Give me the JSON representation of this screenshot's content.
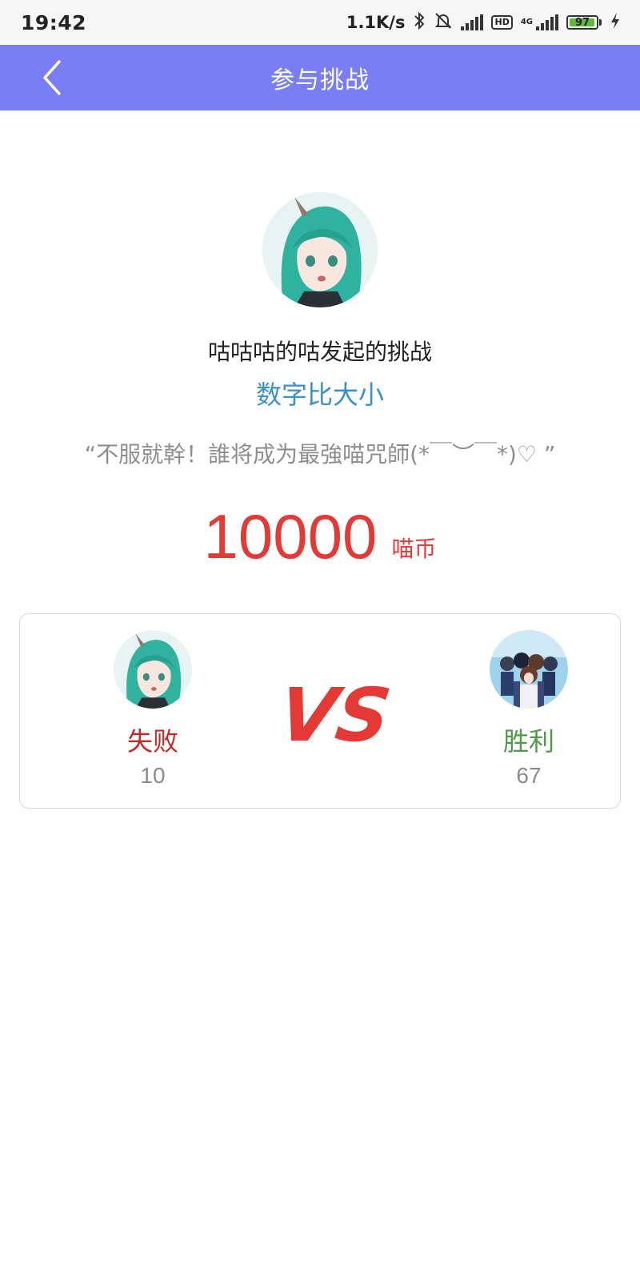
{
  "status_bar": {
    "time": "19:42",
    "net_speed": "1.1K/s",
    "network_type": "4G",
    "hd_label": "HD",
    "battery_level": "97",
    "battery_fraction": 0.97,
    "icons": [
      "bluetooth-icon",
      "mute-icon",
      "signal-icon",
      "signal-icon",
      "charging-icon"
    ]
  },
  "header": {
    "title": "参与挑战",
    "back_icon": "chevron-left-icon"
  },
  "challenge": {
    "initiator_line": "咕咕咕的咕发起的挑战",
    "game_name": "数字比大小",
    "quote": "“不服就幹！誰将成为最強喵咒師(*￣︶￣*)♡ ”",
    "amount": "10000",
    "currency": "喵币"
  },
  "match": {
    "left": {
      "result": "失败",
      "score": "10"
    },
    "vs_label": "VS",
    "right": {
      "result": "胜利",
      "score": "67"
    }
  },
  "colors": {
    "header_bg": "#7a7ef5",
    "game_name": "#3a8fcd",
    "amount": "#e53935",
    "lose": "#c62828",
    "win": "#4f9a45",
    "vs": "#e53935"
  }
}
